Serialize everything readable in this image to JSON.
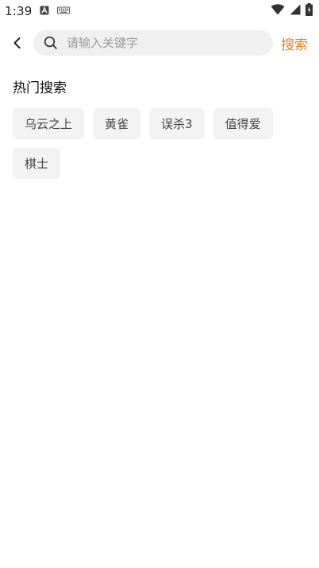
{
  "status_bar": {
    "time": "1:39"
  },
  "search": {
    "placeholder": "请输入关键字",
    "submit_label": "搜索"
  },
  "hot_search": {
    "title": "热门搜索",
    "tags": [
      "乌云之上",
      "黄雀",
      "误杀3",
      "值得爱",
      "棋士"
    ]
  },
  "colors": {
    "accent": "#e6811b",
    "tag_background": "#f3f3f3",
    "search_background": "#f0f0f0"
  },
  "icons": [
    "a-notification-icon",
    "keyboard-icon",
    "wifi-icon",
    "signal-icon",
    "battery-icon",
    "back-arrow-icon",
    "search-icon"
  ]
}
